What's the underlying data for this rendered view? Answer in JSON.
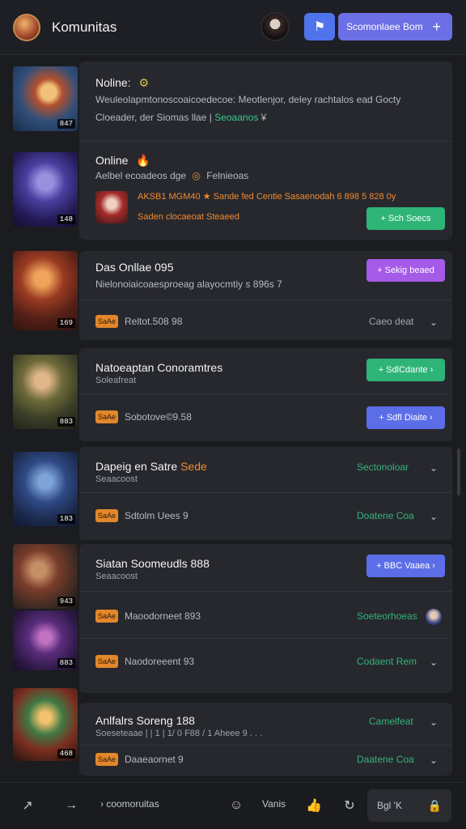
{
  "header": {
    "title": "Komunitas",
    "cta_label": "Scomonlaee Bom",
    "cta_plus": "+",
    "icon_btn": "⚑"
  },
  "posts": [
    {
      "thumb_tag": "847",
      "title": "Noline:",
      "line1": "Weuleolapmtonoscoaicoedecoe: Meotlenjor, deley rachtalos ead Gocty",
      "line2_prefix": "Cloeader, der Siomas llae |",
      "line2_green": "Seoaanos",
      "line2_suffix": "¥"
    },
    {
      "thumb_tag": "148",
      "title": "Online",
      "subtitle": "Aelbel ecoadeos dge",
      "subtitle_suffix": "Felnieoas",
      "orange_line1": "AKSB1 MGM40 ★ Sande fed Centie Sasaenodah 6 898 5 828 0y",
      "orange_line2": "Saden clocaeoat Steaeed",
      "button": "+ Sch Soecs"
    },
    {
      "thumb_tag": "169",
      "title": "Das Onllae 095",
      "body": "Nielonoiaicoaesproeag alayocmtiy s 896s 7",
      "button": "+ Sekig beaed",
      "chip": "SaAe",
      "chip_text": "Reltot.508 98",
      "link": "Caeo deat"
    },
    {
      "thumb_tag": "883",
      "title": "Natoeaptan Conoramtres",
      "subtitle": "Soleafreat",
      "button_top": "+ SdlCdante ›",
      "chip": "SaAe",
      "chip_text": "Sobotove©9.58",
      "button_bottom": "+ Sdfl Diaite ›"
    },
    {
      "thumb_tag": "183",
      "title_prefix": "Dapeig en Satre",
      "title_orange": "Sede",
      "subtitle": "Seaacoost",
      "link_top": "Sectonoloar",
      "chip": "SaAe",
      "chip_text": "Sdtolm Uees 9",
      "link_bottom": "Doatene Coa"
    },
    {
      "thumb_tags": [
        "943",
        "883"
      ],
      "title": "Siatan Soomeudls 888",
      "subtitle": "Seaacoost",
      "button": "+ BBC Vaaea ›",
      "row1_chip": "SaAe",
      "row1_text": "Maoodorneet 893",
      "row1_link": "Soeteorhoeas",
      "row2_chip": "SaAe",
      "row2_text": "Naodoreeent 93",
      "row2_link": "Codaent Rem"
    },
    {
      "thumb_tag": "468",
      "title": "Anlfalrs Soreng 188",
      "subtitle": "Soeseteaae | | 1 | 1/ 0 F88 / 1 Aheee 9 . . .",
      "link_top": "Camelfeat",
      "chip": "SaAe",
      "chip_text": "Daaeaornet 9",
      "link_bottom": "Daatene Coa"
    }
  ],
  "bottom": {
    "breadcrumb": "› coomoruitas",
    "vanis": "Vanis",
    "pill_label": "Bgl 'K"
  }
}
